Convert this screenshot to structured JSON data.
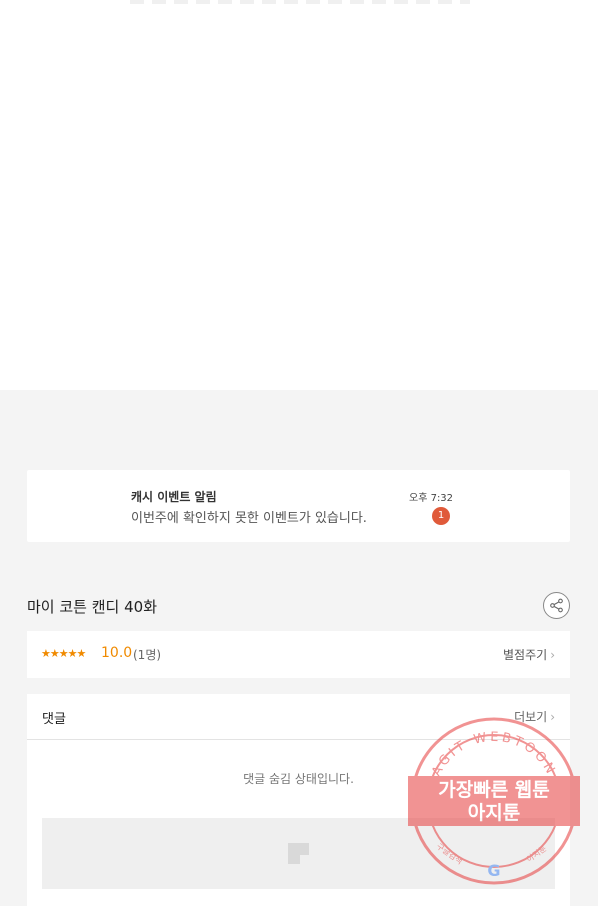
{
  "notification": {
    "title": "캐시 이벤트 알림",
    "message": "이번주에 확인하지 못한 이벤트가 있습니다.",
    "time": "오후 7:32",
    "badge": "1"
  },
  "episode": {
    "title": "마이 코튼 캔디 40화",
    "share_icon": "share-icon"
  },
  "rating": {
    "stars": "★★★★★",
    "score": "10.0",
    "count": "(1명)",
    "rate_label": "별점주기"
  },
  "comments": {
    "title": "댓글",
    "more_label": "더보기",
    "hidden_message": "댓글 숨김 상태입니다."
  },
  "watermark": {
    "arc_text": "AGIT WEBTOON",
    "line1": "가장빠른 웹툰",
    "line2": "아지툰",
    "bottom_left": "구글검색",
    "bottom_right": "아지툰"
  },
  "colors": {
    "accent_orange": "#f08a00",
    "badge_red": "#e05a3a",
    "stamp_red": "#e63c3c"
  }
}
